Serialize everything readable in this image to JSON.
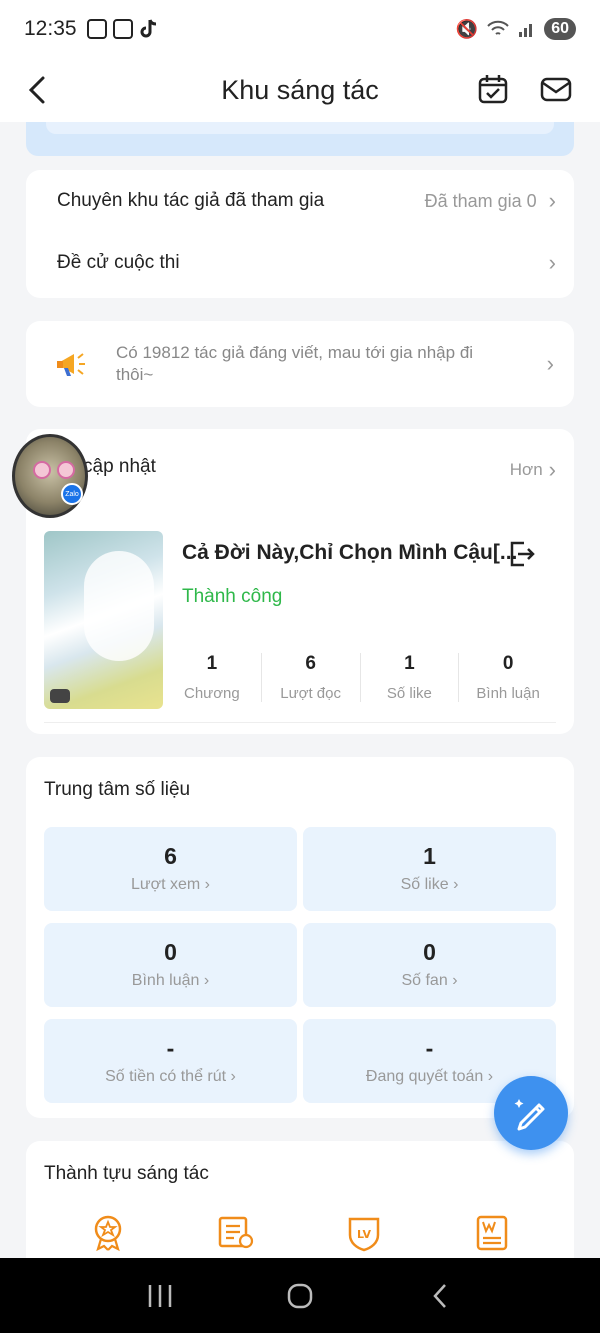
{
  "status": {
    "time": "12:35",
    "battery": "60"
  },
  "header": {
    "title": "Khu sáng tác"
  },
  "sections": {
    "joined_label": "Chuyên khu tác giả đã tham gia",
    "joined_value": "Đã tham gia 0",
    "contest_label": "Đề cử cuộc thi"
  },
  "promo": {
    "text": "Có 19812 tác giả đáng viết, mau tới gia nhập đi thôi~"
  },
  "updates": {
    "title": "cập nhật",
    "more": "Hơn",
    "book": {
      "title": "Cả Đời Này,Chỉ Chọn Mình Cậu[...",
      "status": "Thành công",
      "stats": [
        {
          "value": "1",
          "label": "Chương"
        },
        {
          "value": "6",
          "label": "Lượt đọc"
        },
        {
          "value": "1",
          "label": "Số like"
        },
        {
          "value": "0",
          "label": "Bình luận"
        }
      ]
    }
  },
  "data_center": {
    "title": "Trung tâm số liệu",
    "cells": [
      {
        "value": "6",
        "label": "Lượt xem"
      },
      {
        "value": "1",
        "label": "Số like"
      },
      {
        "value": "0",
        "label": "Bình luận"
      },
      {
        "value": "0",
        "label": "Số fan"
      },
      {
        "value": "-",
        "label": "Số tiền có thể rút"
      },
      {
        "value": "-",
        "label": "Đang quyết toán"
      }
    ]
  },
  "achievements": {
    "title": "Thành tựu sáng tác"
  },
  "colors": {
    "accent": "#3e91ef",
    "success": "#2fb84a",
    "icon_orange": "#f08c1a",
    "panel_blue": "#e9f3fd"
  }
}
